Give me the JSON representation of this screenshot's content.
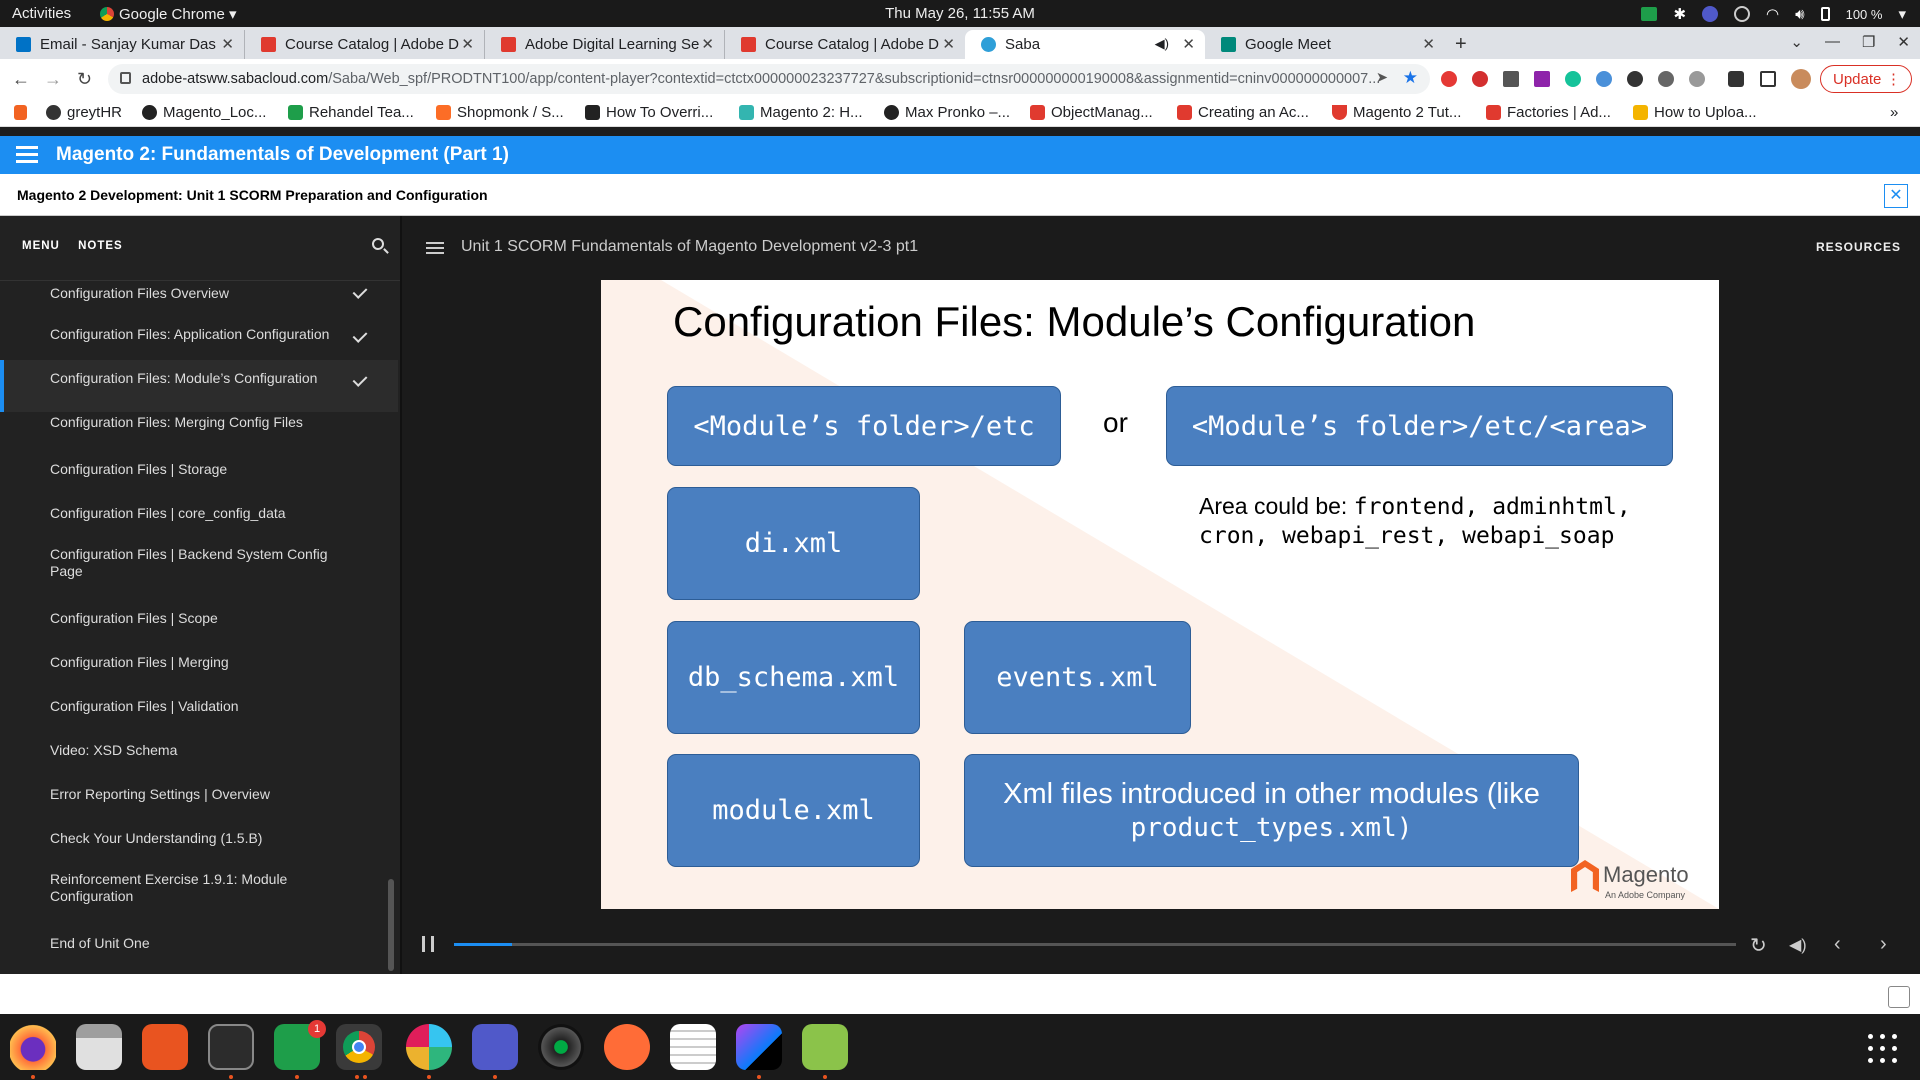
{
  "system": {
    "activities": "Activities",
    "app_name": "Google Chrome",
    "clock": "Thu May 26, 11:55 AM",
    "battery": "100 %"
  },
  "tabs": [
    {
      "label": "Email - Sanjay Kumar Das",
      "color": "#0072c6"
    },
    {
      "label": "Course Catalog | Adobe D",
      "color": "#e03a2f"
    },
    {
      "label": "Adobe Digital Learning Se",
      "color": "#e03a2f"
    },
    {
      "label": "Course Catalog | Adobe D",
      "color": "#e03a2f"
    },
    {
      "label": "Saba",
      "color": "#2f9fd8"
    },
    {
      "label": "Google Meet",
      "color": "#00897b"
    }
  ],
  "address": {
    "host": "adobe-atsww.sabacloud.com",
    "path": "/Saba/Web_spf/PRODTNT100/app/content-player?contextid=ctctx000000023237727&subscriptionid=ctnsr000000000190008&assignmentid=cninv000000000007...",
    "update_label": "Update"
  },
  "bookmarks": [
    {
      "label": "greytHR",
      "color": "#333"
    },
    {
      "label": "Magento_Loc...",
      "color": "#222"
    },
    {
      "label": "Rehandel Tea...",
      "color": "#1e9e4a"
    },
    {
      "label": "Shopmonk / S...",
      "color": "#fc6d26"
    },
    {
      "label": "How To Overri...",
      "color": "#222"
    },
    {
      "label": "Magento 2: H...",
      "color": "#33b5b0"
    },
    {
      "label": "Max Pronko –...",
      "color": "#222"
    },
    {
      "label": "ObjectManag...",
      "color": "#e03a2f"
    },
    {
      "label": "Creating an Ac...",
      "color": "#e03a2f"
    },
    {
      "label": "Magento 2 Tut...",
      "color": "#e03a2f"
    },
    {
      "label": "Factories | Ad...",
      "color": "#e03a2f"
    },
    {
      "label": "How to Uploa...",
      "color": "#f4b400"
    }
  ],
  "course": {
    "title": "Magento 2: Fundamentals of Development (Part 1)",
    "unit_title": "Magento 2 Development: Unit 1 SCORM Preparation and Configuration",
    "player_title": "Unit 1 SCORM Fundamentals of Magento Development v2-3 pt1",
    "resources_label": "RESOURCES",
    "progress": 0.045
  },
  "sidebar": {
    "menu_label": "MENU",
    "notes_label": "NOTES",
    "items": [
      {
        "label": "Configuration Files Overview",
        "done": true,
        "active": false
      },
      {
        "label": "Configuration Files: Application Configuration",
        "done": true,
        "active": false
      },
      {
        "label": "Configuration Files: Module’s Configuration",
        "done": true,
        "active": true
      },
      {
        "label": "Configuration Files: Merging Config Files",
        "done": false,
        "active": false
      },
      {
        "label": "Configuration Files | Storage",
        "done": false,
        "active": false
      },
      {
        "label": "Configuration Files | core_config_data",
        "done": false,
        "active": false
      },
      {
        "label": "Configuration Files | Backend System Config Page",
        "done": false,
        "active": false
      },
      {
        "label": "Configuration Files | Scope",
        "done": false,
        "active": false
      },
      {
        "label": "Configuration Files | Merging",
        "done": false,
        "active": false
      },
      {
        "label": "Configuration Files | Validation",
        "done": false,
        "active": false
      },
      {
        "label": "Video: XSD Schema",
        "done": false,
        "active": false
      },
      {
        "label": "Error Reporting Settings | Overview",
        "done": false,
        "active": false
      },
      {
        "label": "Check Your Understanding (1.5.B)",
        "done": false,
        "active": false
      },
      {
        "label": "Reinforcement Exercise 1.9.1: Module Configuration",
        "done": false,
        "active": false
      },
      {
        "label": "End of Unit One",
        "done": false,
        "active": false
      }
    ]
  },
  "slide": {
    "title": "Configuration Files: Module’s Configuration",
    "folder_etc": "<Module’s folder>/etc",
    "or_label": "or",
    "folder_area": "<Module’s folder>/etc/<area>",
    "area_note_prefix": "Area could be: ",
    "area_note_values": "frontend, adminhtml, cron, webapi_rest, webapi_soap",
    "di": "di.xml",
    "db_schema": "db_schema.xml",
    "events": "events.xml",
    "module": "module.xml",
    "other_prefix": "Xml files introduced in other modules (like",
    "other_code": "product_types.xml)",
    "logo_name": "Magento",
    "logo_sub": "An Adobe Company"
  },
  "dock": {
    "chat_badge": "1"
  }
}
